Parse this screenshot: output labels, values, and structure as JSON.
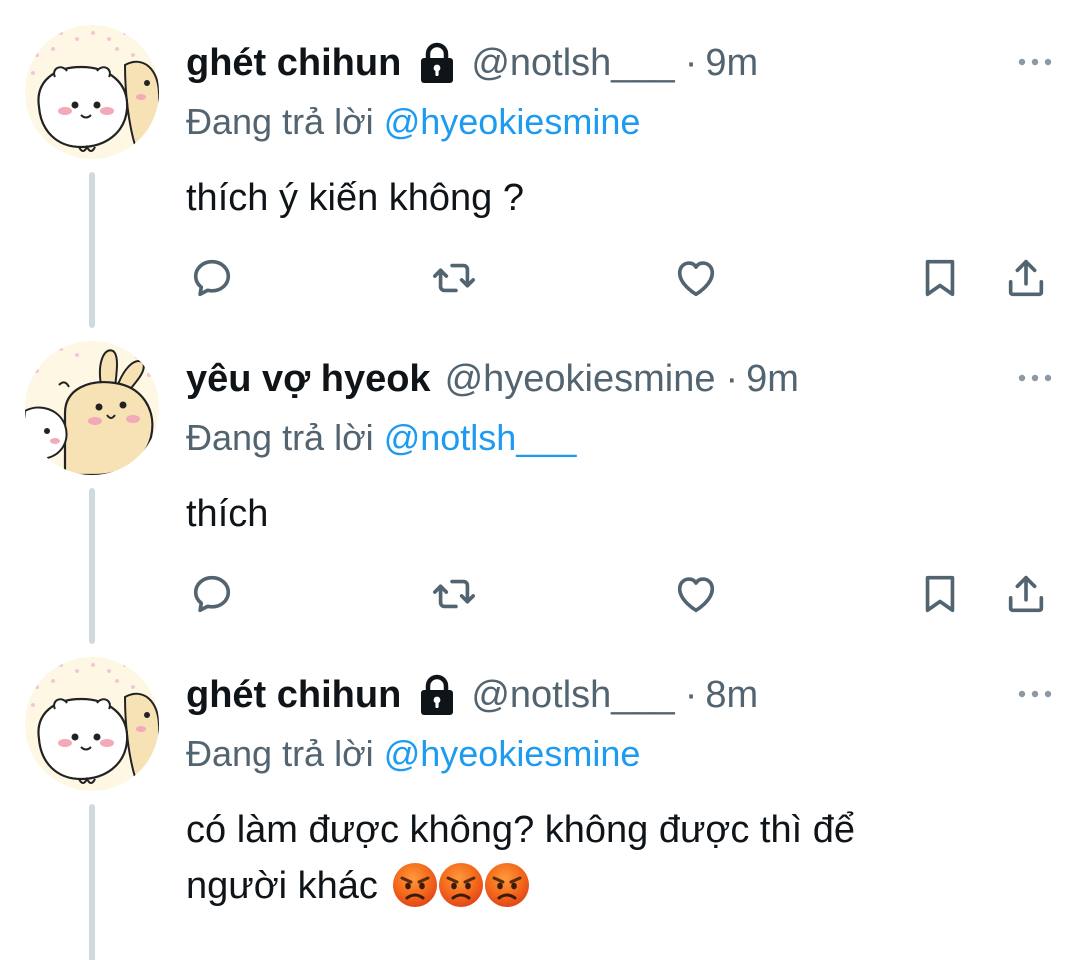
{
  "tweets": [
    {
      "name": "ghét chihun",
      "locked": true,
      "handle": "@notlsh___",
      "separator": "·",
      "time": "9m",
      "reply_prefix": "Đang trả lời",
      "reply_to": "@hyeokiesmine",
      "text": "thích ý kiến không ?",
      "avatar": "hamster-avatar"
    },
    {
      "name": "yêu vợ hyeok",
      "locked": false,
      "handle": "@hyeokiesmine",
      "separator": "·",
      "time": "9m",
      "reply_prefix": "Đang trả lời",
      "reply_to": "@notlsh___",
      "text": "thích",
      "avatar": "bunny-avatar"
    },
    {
      "name": "ghét chihun",
      "locked": true,
      "handle": "@notlsh___",
      "separator": "·",
      "time": "8m",
      "reply_prefix": "Đang trả lời",
      "reply_to": "@hyeokiesmine",
      "text_line1": "có làm được không? không được thì để",
      "text_line2": "người khác",
      "emojis": [
        "angry-face-emoji",
        "angry-face-emoji",
        "angry-face-emoji"
      ],
      "avatar": "hamster-avatar"
    }
  ],
  "actions": [
    "reply-icon",
    "retweet-icon",
    "like-icon",
    "bookmark-icon",
    "share-icon"
  ],
  "colors": {
    "text": "#0f1419",
    "secondary": "#536471",
    "mention": "#1d9bf0",
    "thread_line": "#cfd9de",
    "icon": "#536471"
  }
}
